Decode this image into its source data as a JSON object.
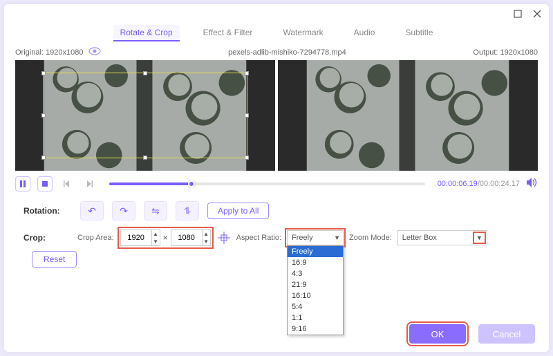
{
  "tabs": [
    "Rotate & Crop",
    "Effect & Filter",
    "Watermark",
    "Audio",
    "Subtitle"
  ],
  "activeTab": 0,
  "info": {
    "originalLabel": "Original: 1920x1080",
    "filename": "pexels-adlib-mishiko-7294778.mp4",
    "outputLabel": "Output: 1920x1080"
  },
  "time": {
    "current": "00:00:06.19",
    "total": "00:00:24.17"
  },
  "rotation": {
    "label": "Rotation:",
    "applyAll": "Apply to All"
  },
  "crop": {
    "label": "Crop:",
    "areaLabel": "Crop Area:",
    "w": "1920",
    "h": "1080",
    "aspectLabel": "Aspect Ratio:",
    "aspectValue": "Freely",
    "aspectOptions": [
      "Freely",
      "16:9",
      "4:3",
      "21:9",
      "16:10",
      "5:4",
      "1:1",
      "9:16"
    ],
    "zoomLabel": "Zoom Mode:",
    "zoomValue": "Letter Box",
    "reset": "Reset"
  },
  "footer": {
    "ok": "OK",
    "cancel": "Cancel"
  }
}
